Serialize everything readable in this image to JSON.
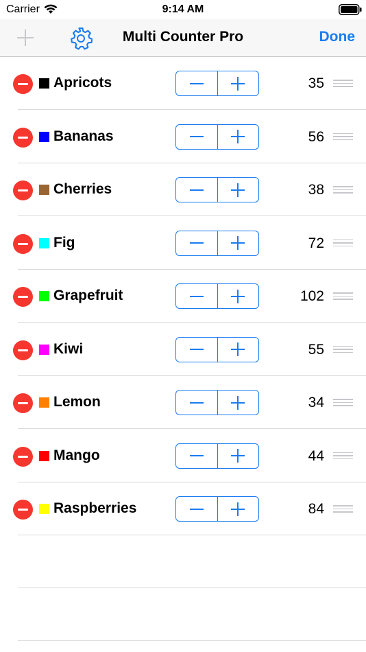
{
  "status_bar": {
    "carrier": "Carrier",
    "time": "9:14 AM"
  },
  "nav": {
    "title": "Multi Counter Pro",
    "done_label": "Done",
    "add_icon": "plus-icon",
    "settings_icon": "gear-icon"
  },
  "colors": {
    "accent": "#1a7cf2",
    "delete": "#f6372f",
    "disabled": "#c7c7cc"
  },
  "counters": [
    {
      "name": "Apricots",
      "color": "#000000",
      "count": "35"
    },
    {
      "name": "Bananas",
      "color": "#0000ff",
      "count": "56"
    },
    {
      "name": "Cherries",
      "color": "#996633",
      "count": "38"
    },
    {
      "name": "Fig",
      "color": "#00ffff",
      "count": "72"
    },
    {
      "name": "Grapefruit",
      "color": "#00ff00",
      "count": "102"
    },
    {
      "name": "Kiwi",
      "color": "#ff00ff",
      "count": "55"
    },
    {
      "name": "Lemon",
      "color": "#ff8000",
      "count": "34"
    },
    {
      "name": "Mango",
      "color": "#ff0000",
      "count": "44"
    },
    {
      "name": "Raspberries",
      "color": "#ffff00",
      "count": "84"
    }
  ]
}
